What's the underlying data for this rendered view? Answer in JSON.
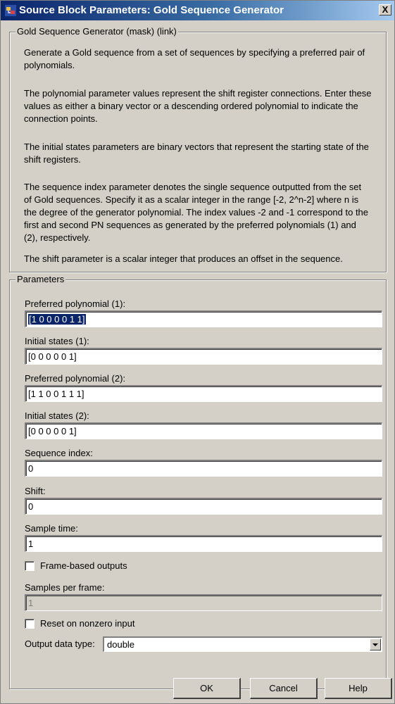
{
  "window": {
    "title": "Source Block Parameters: Gold Sequence Generator",
    "close_label": "X"
  },
  "mask": {
    "group_label": "Gold Sequence Generator (mask) (link)",
    "paragraphs": [
      [
        "Generate a Gold sequence from a set of sequences by specifying a preferred pair of",
        "polynomials."
      ],
      [
        "The polynomial parameter values represent the shift register connections. Enter these",
        "values as either a binary vector or a descending ordered polynomial to indicate the",
        "connection points."
      ],
      [
        "The initial states parameters are binary vectors that represent the starting state of the",
        "shift registers."
      ],
      [
        "The sequence index parameter denotes the single sequence outputted from the set",
        "of Gold sequences. Specify it as a scalar integer in the range [-2, 2^n-2] where n is",
        "the degree of the generator polynomial. The index values -2 and -1 correspond to the",
        "first and second PN sequences as generated by the preferred polynomials (1) and",
        "(2), respectively."
      ],
      [
        "The shift parameter is a scalar integer that produces an offset in the sequence."
      ]
    ]
  },
  "params": {
    "group_label": "Parameters",
    "pref_poly_1": {
      "label": "Preferred polynomial (1):",
      "value": "[1 0 0 0 0 1 1]"
    },
    "init_states_1": {
      "label": "Initial states (1):",
      "value": "[0 0 0 0 0 1]"
    },
    "pref_poly_2": {
      "label": "Preferred polynomial (2):",
      "value": "[1 1 0 0 1 1 1]"
    },
    "init_states_2": {
      "label": "Initial states (2):",
      "value": "[0 0 0 0 0 1]"
    },
    "sequence_index": {
      "label": "Sequence index:",
      "value": "0"
    },
    "shift": {
      "label": "Shift:",
      "value": "0"
    },
    "sample_time": {
      "label": "Sample time:",
      "value": "1"
    },
    "frame_based": {
      "label": "Frame-based outputs",
      "checked": false
    },
    "samples_per_frame": {
      "label": "Samples per frame:",
      "value": "1",
      "enabled": false
    },
    "reset": {
      "label": "Reset on nonzero input",
      "checked": false
    },
    "output_data_type": {
      "label": "Output data type:",
      "value": "double"
    }
  },
  "buttons": {
    "ok": "OK",
    "cancel": "Cancel",
    "help": "Help"
  }
}
